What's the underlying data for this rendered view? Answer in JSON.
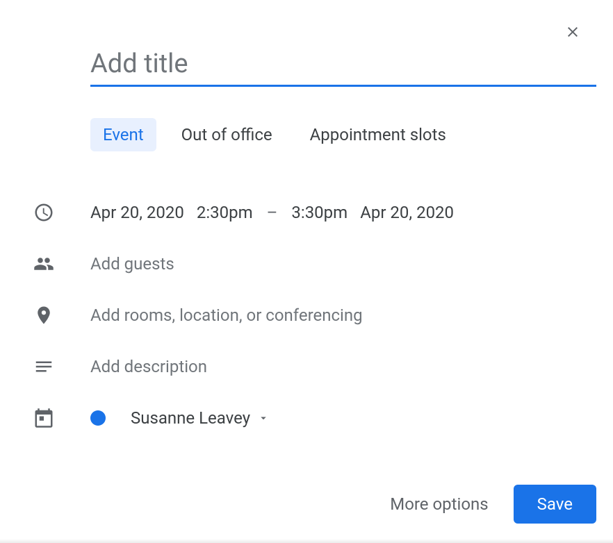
{
  "title_placeholder": "Add title",
  "tabs": {
    "event": "Event",
    "ooo": "Out of office",
    "slots": "Appointment slots"
  },
  "datetime": {
    "start_date": "Apr 20, 2020",
    "start_time": "2:30pm",
    "dash": "–",
    "end_time": "3:30pm",
    "end_date": "Apr 20, 2020"
  },
  "guests_placeholder": "Add guests",
  "location_placeholder": "Add rooms, location, or conferencing",
  "description_placeholder": "Add description",
  "calendar": {
    "color": "#1a73e8",
    "name": "Susanne Leavey"
  },
  "footer": {
    "more_options": "More options",
    "save": "Save"
  }
}
